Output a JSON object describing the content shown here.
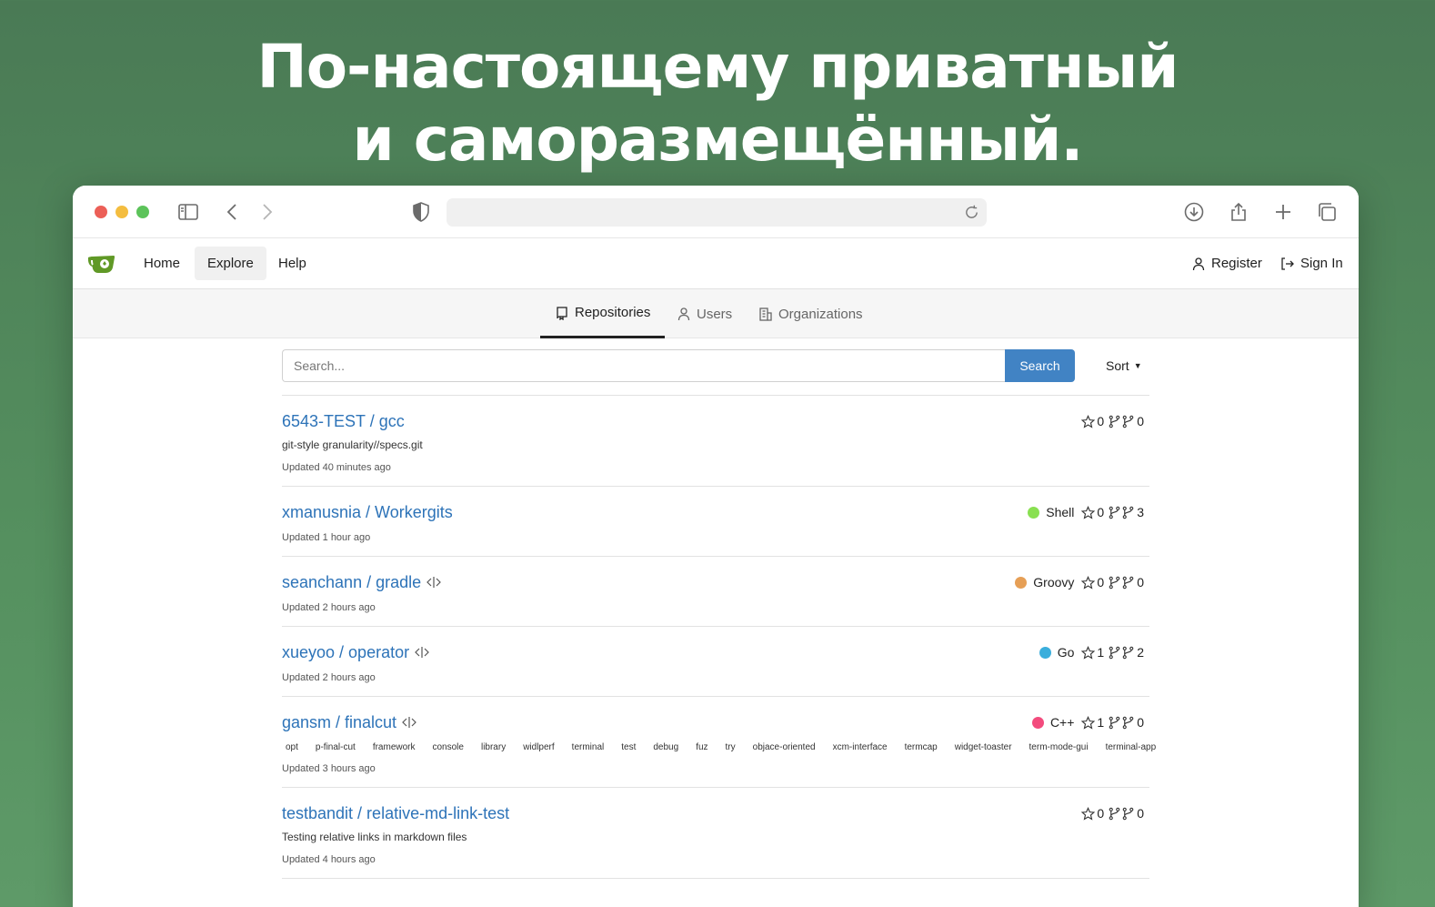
{
  "headline": {
    "line1": "По-настоящему приватный",
    "line2": "и саморазмещённый."
  },
  "nav": {
    "home": "Home",
    "explore": "Explore",
    "help": "Help",
    "register": "Register",
    "sign_in": "Sign In"
  },
  "tabs": {
    "repositories": "Repositories",
    "users": "Users",
    "organizations": "Organizations"
  },
  "search": {
    "placeholder": "Search...",
    "button": "Search",
    "sort": "Sort"
  },
  "repos": [
    {
      "title": "6543-TEST / gcc",
      "description": "git-style granularity//specs.git",
      "updated": "Updated 40 minutes ago",
      "stars": "0",
      "forks": "0",
      "mirror": false
    },
    {
      "title": "xmanusnia / Workergits",
      "updated": "Updated 1 hour ago",
      "language": "Shell",
      "language_color": "#89e051",
      "stars": "0",
      "forks": "3",
      "mirror": false
    },
    {
      "title": "seanchann / gradle",
      "updated": "Updated 2 hours ago",
      "language": "Groovy",
      "language_color": "#e69f56",
      "stars": "0",
      "forks": "0",
      "mirror": true
    },
    {
      "title": "xueyoo / operator",
      "updated": "Updated 2 hours ago",
      "language": "Go",
      "language_color": "#3aaedc",
      "stars": "1",
      "forks": "2",
      "mirror": true
    },
    {
      "title": "gansm / finalcut",
      "updated": "Updated 3 hours ago",
      "language": "C++",
      "language_color": "#f34b7d",
      "stars": "1",
      "forks": "0",
      "mirror": true,
      "topics": [
        "opt",
        "p-final-cut",
        "framework",
        "console",
        "library",
        "widlperf",
        "terminal",
        "test",
        "debug",
        "fuz",
        "try",
        "objace-oriented",
        "xcm-interface",
        "termcap",
        "widget-toaster",
        "term-mode-gui",
        "terminal-app"
      ]
    },
    {
      "title": "testbandit / relative-md-link-test",
      "description": "Testing relative links in markdown files",
      "updated": "Updated 4 hours ago",
      "stars": "0",
      "forks": "0",
      "mirror": false
    }
  ]
}
